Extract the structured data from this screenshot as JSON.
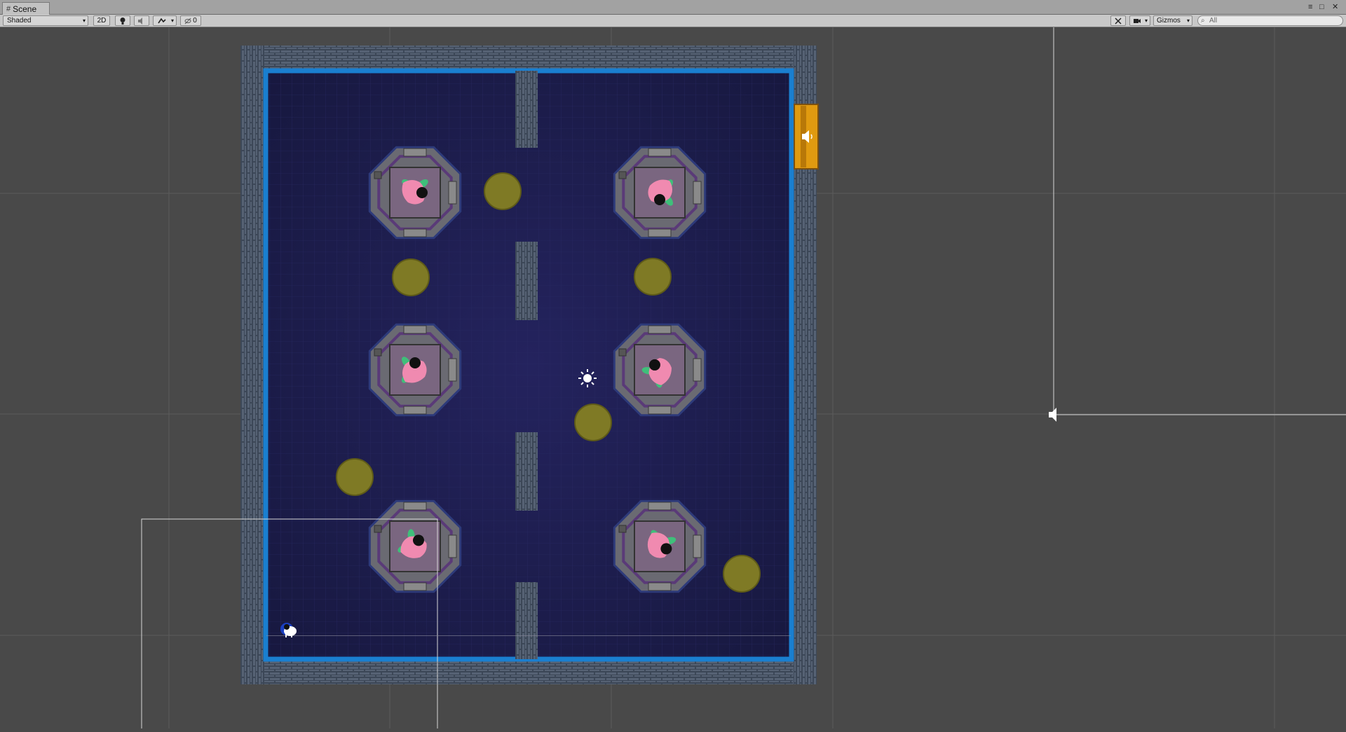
{
  "window": {
    "tab_label": "Scene",
    "controls": [
      "≡",
      "□",
      "✕"
    ]
  },
  "toolbar": {
    "shading_mode": "Shaded",
    "mode_2d": "2D",
    "gizmos_label": "Gizmos",
    "search_placeholder": "All",
    "hidden_count": "0"
  },
  "scene": {
    "stations": [
      {
        "row": 0,
        "col": 0,
        "char_rot": 0
      },
      {
        "row": 0,
        "col": 1,
        "char_rot": 90
      },
      {
        "row": 1,
        "col": 0,
        "char_rot": -90
      },
      {
        "row": 1,
        "col": 1,
        "char_rot": 225
      },
      {
        "row": 2,
        "col": 0,
        "char_rot": 300
      },
      {
        "row": 2,
        "col": 1,
        "char_rot": 20
      }
    ],
    "colors": {
      "floor": "#1c1c52",
      "border": "#1a7fd0",
      "wall": "#3e4a5a",
      "token": "#7f7a25",
      "speaker_door": "#e09a10",
      "character_body": "#f08ab0",
      "character_limb": "#3fbf7a"
    },
    "icons": [
      "sun-light-icon",
      "audio-source-icon",
      "player-icon"
    ]
  }
}
